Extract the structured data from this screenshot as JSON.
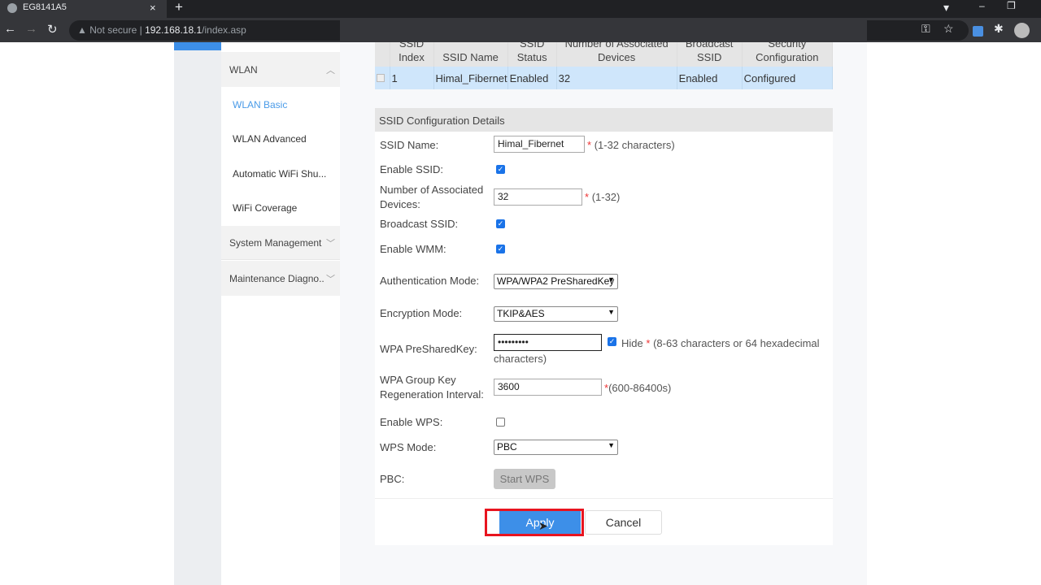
{
  "browser": {
    "tab_title": "EG8141A5",
    "security": "Not secure",
    "url_host": "192.168.18.1",
    "url_path": "/index.asp",
    "new_tab": "+",
    "close": "×"
  },
  "sidebar": {
    "groups": [
      {
        "label": "WLAN",
        "expanded": true
      },
      {
        "label": "System Management",
        "expanded": false
      },
      {
        "label": "Maintenance Diagno..",
        "expanded": false
      }
    ],
    "items": [
      {
        "label": "WLAN Basic",
        "active": true
      },
      {
        "label": "WLAN Advanced"
      },
      {
        "label": "Automatic WiFi Shu..."
      },
      {
        "label": "WiFi Coverage"
      }
    ]
  },
  "table": {
    "headers": [
      "SSID Index",
      "SSID Name",
      "SSID Status",
      "Number of Associated Devices",
      "Broadcast SSID",
      "Security Configuration"
    ],
    "rows": [
      [
        "1",
        "Himal_Fibernet",
        "Enabled",
        "32",
        "Enabled",
        "Configured"
      ]
    ]
  },
  "form": {
    "section_title": "SSID Configuration Details",
    "ssid_name": {
      "label": "SSID Name:",
      "value": "Himal_Fibernet",
      "hint": "(1-32 characters)"
    },
    "enable_ssid": {
      "label": "Enable SSID:",
      "checked": true
    },
    "assoc_devices": {
      "label": "Number of Associated Devices:",
      "value": "32",
      "hint": "(1-32)"
    },
    "broadcast_ssid": {
      "label": "Broadcast SSID:",
      "checked": true
    },
    "enable_wmm": {
      "label": "Enable WMM:",
      "checked": true
    },
    "auth_mode": {
      "label": "Authentication Mode:",
      "value": "WPA/WPA2 PreSharedKey"
    },
    "encryption_mode": {
      "label": "Encryption Mode:",
      "value": "TKIP&AES"
    },
    "psk": {
      "label": "WPA PreSharedKey:",
      "value": "•••••••••",
      "hide_label": "Hide",
      "hide_checked": true,
      "hint": "(8-63 characters or 64 hexadecimal characters)"
    },
    "group_key": {
      "label": "WPA Group Key Regeneration Interval:",
      "value": "3600",
      "hint": "(600-86400s)"
    },
    "enable_wps": {
      "label": "Enable WPS:",
      "checked": false
    },
    "wps_mode": {
      "label": "WPS Mode:",
      "value": "PBC"
    },
    "pbc": {
      "label": "PBC:",
      "button": "Start WPS"
    },
    "star": "*",
    "apply": "Apply",
    "cancel": "Cancel"
  },
  "colors": {
    "accent": "#3d8fe8",
    "highlight": "#e8141f",
    "row_selected": "#cfe6fb"
  }
}
